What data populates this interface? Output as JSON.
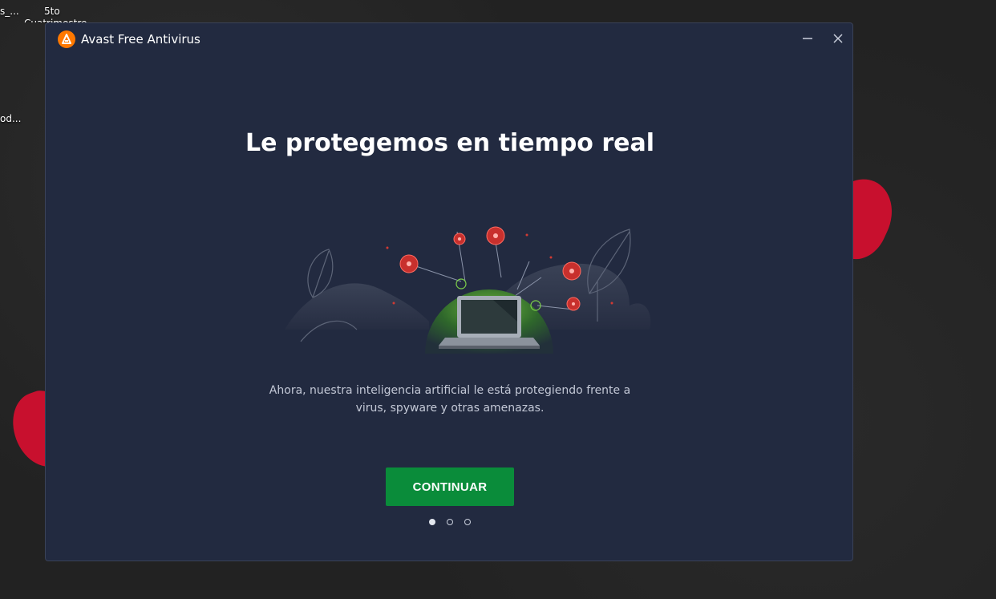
{
  "desktop": {
    "icon_labels": [
      "s_...",
      "5to",
      "Cuatrimestre",
      "od..."
    ]
  },
  "window": {
    "title": "Avast Free Antivirus",
    "controls": {
      "minimize": "minimize-icon",
      "close": "close-icon"
    }
  },
  "onboarding": {
    "heading": "Le protegemos en tiempo real",
    "description_line1": "Ahora, nuestra inteligencia artificial le está protegiendo frente a",
    "description_line2": "virus, spyware y otras amenazas.",
    "continue_label": "CONTINUAR",
    "page_count": 3,
    "current_page": 1
  },
  "colors": {
    "window_bg": "#222a40",
    "accent_green": "#0a8c3a",
    "brand_orange": "#ff7800"
  }
}
